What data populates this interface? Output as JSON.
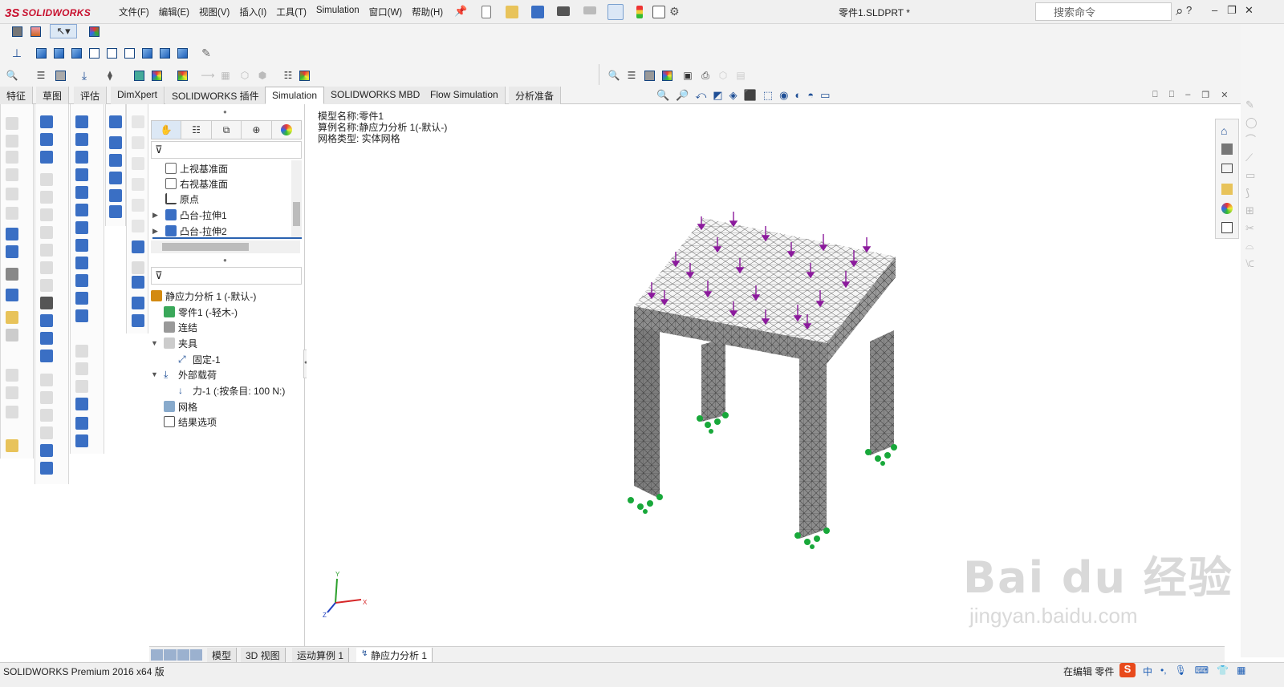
{
  "app": {
    "logo_ds": "3S",
    "logo_text": "SOLIDWORKS",
    "doc_title": "零件1.SLDPRT *"
  },
  "menu": [
    "文件(F)",
    "编辑(E)",
    "视图(V)",
    "插入(I)",
    "工具(T)",
    "Simulation",
    "窗口(W)",
    "帮助(H)"
  ],
  "search": {
    "placeholder": "搜索命令"
  },
  "window_controls": {
    "help": "?",
    "minimize": "–",
    "restore": "❐",
    "close": "✕"
  },
  "tabs": [
    {
      "label": "特征",
      "active": false
    },
    {
      "label": "草图",
      "active": false
    },
    {
      "label": "评估",
      "active": false
    },
    {
      "label": "DimXpert",
      "active": false
    },
    {
      "label": "SOLIDWORKS 插件",
      "active": false
    },
    {
      "label": "Simulation",
      "active": true
    },
    {
      "label": "SOLIDWORKS MBD",
      "active": false
    },
    {
      "label": "Flow Simulation",
      "active": false
    },
    {
      "label": "分析准备",
      "active": false
    }
  ],
  "feature_tree": {
    "items": [
      {
        "label": "上视基准面",
        "icon": "plane-icon"
      },
      {
        "label": "右视基准面",
        "icon": "plane-icon"
      },
      {
        "label": "原点",
        "icon": "origin-icon"
      },
      {
        "label": "凸台-拉伸1",
        "icon": "extrude-icon"
      },
      {
        "label": "凸台-拉伸2",
        "icon": "extrude-icon"
      }
    ]
  },
  "study_tree": {
    "root": "静应力分析 1 (-默认-)",
    "items": [
      {
        "label": "零件1 (-轻木-)"
      },
      {
        "label": "连结"
      },
      {
        "label": "夹具"
      },
      {
        "label": "固定-1"
      },
      {
        "label": "外部载荷"
      },
      {
        "label": "力-1 (:按条目: 100 N:)"
      },
      {
        "label": "网格"
      },
      {
        "label": "结果选项"
      }
    ]
  },
  "viewport": {
    "model_name": "模型名称:零件1",
    "study_name": "算例名称:静应力分析 1(-默认-)",
    "mesh_type": "网格类型: 实体网格",
    "axis_labels": {
      "y": "Y",
      "x": "X",
      "z": "Z"
    }
  },
  "bottom_tabs": [
    {
      "label": "模型",
      "active": false
    },
    {
      "label": "3D 视图",
      "active": false
    },
    {
      "label": "运动算例 1",
      "active": false
    },
    {
      "label": "静应力分析 1",
      "active": true
    }
  ],
  "status": {
    "left": "SOLIDWORKS Premium 2016 x64 版",
    "right": "在编辑 零件"
  },
  "watermark": {
    "brand": "Bai du 经验",
    "url": "jingyan.baidu.com"
  },
  "colors": {
    "accent_red": "#c8102e",
    "load_arrow": "#8b1a9c",
    "fixture": "#18a83a"
  }
}
